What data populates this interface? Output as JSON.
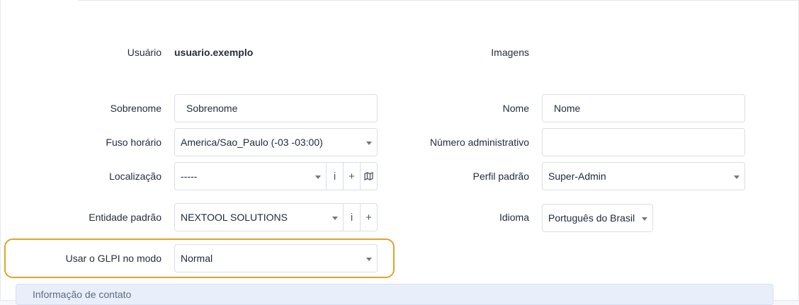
{
  "user": {
    "label": "Usuário",
    "value": "usuario.exemplo"
  },
  "images": {
    "label": "Imagens"
  },
  "lastname": {
    "label": "Sobrenome",
    "value": "Sobrenome"
  },
  "firstname": {
    "label": "Nome",
    "value": "Nome"
  },
  "timezone": {
    "label": "Fuso horário",
    "value": "America/Sao_Paulo (-03 -03:00)"
  },
  "admin_number": {
    "label": "Número administrativo",
    "value": ""
  },
  "location": {
    "label": "Localização",
    "value": "-----",
    "info_icon": "i",
    "add_icon": "+"
  },
  "profile": {
    "label": "Perfil padrão",
    "value": "Super-Admin"
  },
  "entity": {
    "label": "Entidade padrão",
    "value": "NEXTOOL SOLUTIONS",
    "info_icon": "i",
    "add_icon": "+"
  },
  "language": {
    "label": "Idioma",
    "value": "Português do Brasil"
  },
  "mode": {
    "label": "Usar o GLPI no modo",
    "value": "Normal"
  },
  "contact_section": {
    "title": "Informação de contato"
  },
  "colors": {
    "highlight": "#e2a228",
    "section_bg": "#e9effa"
  }
}
